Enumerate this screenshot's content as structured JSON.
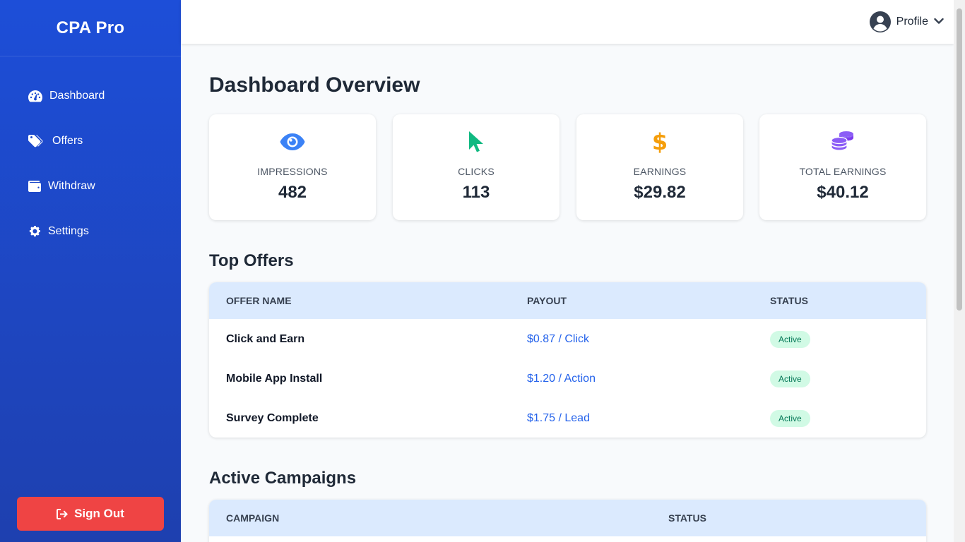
{
  "app": {
    "brand": "CPA Pro"
  },
  "sidebar": {
    "items": [
      {
        "label": "Dashboard",
        "icon": "gauge-icon"
      },
      {
        "label": "Offers",
        "icon": "tags-icon"
      },
      {
        "label": "Withdraw",
        "icon": "wallet-icon"
      },
      {
        "label": "Settings",
        "icon": "gear-icon"
      }
    ],
    "signout_label": "Sign Out",
    "signout_icon": "sign-out-icon"
  },
  "header": {
    "profile_label": "Profile"
  },
  "main": {
    "title": "Dashboard Overview",
    "stats": [
      {
        "label": "IMPRESSIONS",
        "value": "482",
        "icon": "eye-icon",
        "color": "#3b82f6"
      },
      {
        "label": "CLICKS",
        "value": "113",
        "icon": "cursor-icon",
        "color": "#10b981"
      },
      {
        "label": "EARNINGS",
        "value": "$29.82",
        "icon": "dollar-icon",
        "color": "#f59e0b"
      },
      {
        "label": "TOTAL EARNINGS",
        "value": "$40.12",
        "icon": "coins-icon",
        "color": "#8b5cf6"
      }
    ],
    "top_offers": {
      "title": "Top Offers",
      "columns": [
        "OFFER NAME",
        "PAYOUT",
        "STATUS"
      ],
      "rows": [
        {
          "name": "Click and Earn",
          "payout": "$0.87 / Click",
          "status": "Active"
        },
        {
          "name": "Mobile App Install",
          "payout": "$1.20 / Action",
          "status": "Active"
        },
        {
          "name": "Survey Complete",
          "payout": "$1.75 / Lead",
          "status": "Active"
        }
      ]
    },
    "active_campaigns": {
      "title": "Active Campaigns",
      "columns": [
        "CAMPAIGN",
        "STATUS"
      ]
    }
  },
  "colors": {
    "sidebar": "#1d4ed8",
    "signout": "#ef4444",
    "table_header": "#dbeafe",
    "link": "#2563eb",
    "badge_bg": "#d1fae5",
    "badge_text": "#047857"
  }
}
